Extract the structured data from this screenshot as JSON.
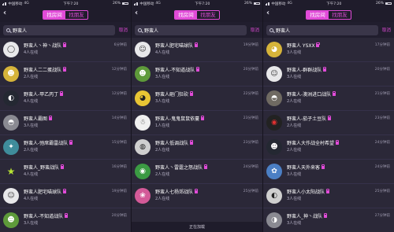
{
  "status": {
    "carrier": "中国移动",
    "network": "4G",
    "time": "下午7:20",
    "battery": "26%"
  },
  "header": {
    "tab_active": "找房间",
    "tab_inactive": "找朋友",
    "back_icon": "‹"
  },
  "search": {
    "query": "野蛮人",
    "cancel": "取消"
  },
  "screens": [
    {
      "rows": [
        {
          "title": "野蛮人丶神丶战队",
          "sub": "4人在线",
          "time": "6分钟前",
          "avatar": "av-white",
          "glyph": "◯"
        },
        {
          "title": "野蛮人二二蛋战队",
          "sub": "2人在线",
          "time": "12分钟前",
          "avatar": "av-yellow",
          "glyph": "☻"
        },
        {
          "title": "野蛮人-甲乙丙丁",
          "sub": "4人在线",
          "time": "12分钟前",
          "avatar": "av-dark",
          "glyph": "◐"
        },
        {
          "title": "野蛮人霸图",
          "sub": "3人在线",
          "time": "14分钟前",
          "avatar": "av-grey",
          "glyph": "◓"
        },
        {
          "title": "野蛮人-弛席霸雷战队",
          "sub": "2人在线",
          "time": "15分钟前",
          "avatar": "av-teal",
          "glyph": "✦"
        },
        {
          "title": "野蛮人_野蛮战队",
          "sub": "4人在线",
          "time": "16分钟前",
          "avatar": "av-star",
          "glyph": "★"
        },
        {
          "title": "野蛮人肥宅喵球队",
          "sub": "4人在线",
          "time": "19分钟前",
          "avatar": "av-white",
          "glyph": "☺"
        },
        {
          "title": "野蛮人-不知道战队",
          "sub": "3人在线",
          "time": "20分钟前",
          "avatar": "av-green",
          "glyph": "☻"
        }
      ]
    },
    {
      "rows": [
        {
          "title": "野蛮人肥宅喵球队",
          "sub": "4人在线",
          "time": "19分钟前",
          "avatar": "av-white",
          "glyph": "☺"
        },
        {
          "title": "野蛮人-不知道战队",
          "sub": "3人在线",
          "time": "20分钟前",
          "avatar": "av-green",
          "glyph": "☻"
        },
        {
          "title": "野蛮人砸门狂砍",
          "sub": "3人在线",
          "time": "22分钟前",
          "avatar": "av-pika",
          "glyph": "◕"
        },
        {
          "title": "野蛮人-鬼鬼鼠鼠依蔓",
          "sub": "1人在线",
          "time": "23分钟前",
          "avatar": "av-snow",
          "glyph": "☃"
        },
        {
          "title": "野蛮人低调战队",
          "sub": "2人在线",
          "time": "23分钟前",
          "avatar": "av-bw",
          "glyph": "◍"
        },
        {
          "title": "野蛮人丶雷霆之怒战队",
          "sub": "2人在线",
          "time": "24分钟前",
          "avatar": "av-frog",
          "glyph": "◉"
        },
        {
          "title": "野蛮人七杨郊战队",
          "sub": "2人在线",
          "time": "25分钟前",
          "avatar": "av-pink",
          "glyph": "❀"
        }
      ],
      "footer": "正在加载"
    },
    {
      "rows": [
        {
          "title": "野蛮人 YSXX",
          "sub": "3人在线",
          "time": "17分钟前",
          "avatar": "av-yellow",
          "glyph": "◕"
        },
        {
          "title": "野蛮人-群群战队",
          "sub": "3人在线",
          "time": "20分钟前",
          "avatar": "av-white",
          "glyph": "☺"
        },
        {
          "title": "野蛮人-澳洲进口战队",
          "sub": "2人在线",
          "time": "21分钟前",
          "avatar": "av-photo",
          "glyph": "◓"
        },
        {
          "title": "野蛮人-茄子土豆队",
          "sub": "2人在线",
          "time": "23分钟前",
          "avatar": "av-red",
          "glyph": "◉"
        },
        {
          "title": "野蛮人大作战全村希望",
          "sub": "2人在线",
          "time": "24分钟前",
          "avatar": "av-dark",
          "glyph": "☻"
        },
        {
          "title": "野蛮人天外来客",
          "sub": "3人在线",
          "time": "24分钟前",
          "avatar": "av-blue",
          "glyph": "✿"
        },
        {
          "title": "野蛮人小太阳战队",
          "sub": "3人在线",
          "time": "25分钟前",
          "avatar": "av-bw",
          "glyph": "◐"
        },
        {
          "title": "野蛮人_神丶战队",
          "sub": "3人在线",
          "time": "27分钟前",
          "avatar": "av-grey",
          "glyph": "◑"
        }
      ]
    }
  ]
}
